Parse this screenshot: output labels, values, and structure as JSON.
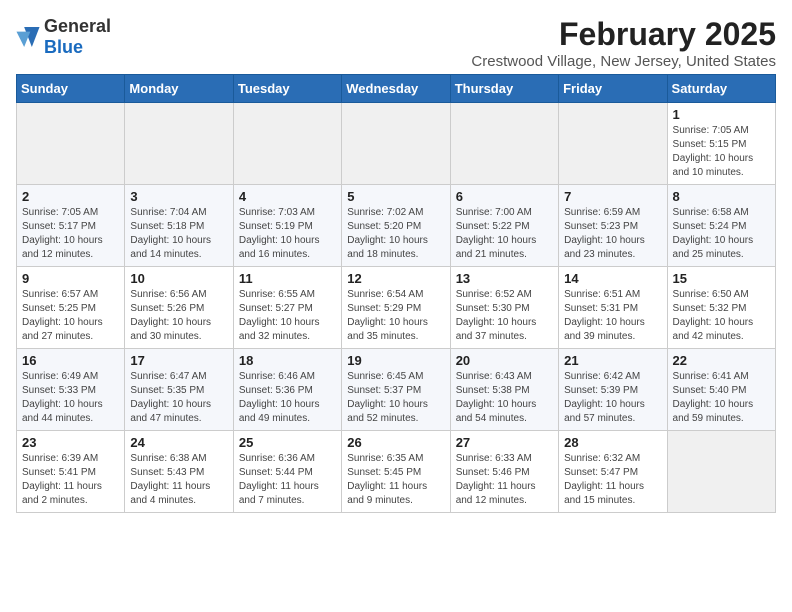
{
  "logo": {
    "general": "General",
    "blue": "Blue"
  },
  "title": "February 2025",
  "location": "Crestwood Village, New Jersey, United States",
  "weekdays": [
    "Sunday",
    "Monday",
    "Tuesday",
    "Wednesday",
    "Thursday",
    "Friday",
    "Saturday"
  ],
  "weeks": [
    [
      {
        "day": "",
        "info": ""
      },
      {
        "day": "",
        "info": ""
      },
      {
        "day": "",
        "info": ""
      },
      {
        "day": "",
        "info": ""
      },
      {
        "day": "",
        "info": ""
      },
      {
        "day": "",
        "info": ""
      },
      {
        "day": "1",
        "info": "Sunrise: 7:05 AM\nSunset: 5:15 PM\nDaylight: 10 hours\nand 10 minutes."
      }
    ],
    [
      {
        "day": "2",
        "info": "Sunrise: 7:05 AM\nSunset: 5:17 PM\nDaylight: 10 hours\nand 12 minutes."
      },
      {
        "day": "3",
        "info": "Sunrise: 7:04 AM\nSunset: 5:18 PM\nDaylight: 10 hours\nand 14 minutes."
      },
      {
        "day": "4",
        "info": "Sunrise: 7:03 AM\nSunset: 5:19 PM\nDaylight: 10 hours\nand 16 minutes."
      },
      {
        "day": "5",
        "info": "Sunrise: 7:02 AM\nSunset: 5:20 PM\nDaylight: 10 hours\nand 18 minutes."
      },
      {
        "day": "6",
        "info": "Sunrise: 7:00 AM\nSunset: 5:22 PM\nDaylight: 10 hours\nand 21 minutes."
      },
      {
        "day": "7",
        "info": "Sunrise: 6:59 AM\nSunset: 5:23 PM\nDaylight: 10 hours\nand 23 minutes."
      },
      {
        "day": "8",
        "info": "Sunrise: 6:58 AM\nSunset: 5:24 PM\nDaylight: 10 hours\nand 25 minutes."
      }
    ],
    [
      {
        "day": "9",
        "info": "Sunrise: 6:57 AM\nSunset: 5:25 PM\nDaylight: 10 hours\nand 27 minutes."
      },
      {
        "day": "10",
        "info": "Sunrise: 6:56 AM\nSunset: 5:26 PM\nDaylight: 10 hours\nand 30 minutes."
      },
      {
        "day": "11",
        "info": "Sunrise: 6:55 AM\nSunset: 5:27 PM\nDaylight: 10 hours\nand 32 minutes."
      },
      {
        "day": "12",
        "info": "Sunrise: 6:54 AM\nSunset: 5:29 PM\nDaylight: 10 hours\nand 35 minutes."
      },
      {
        "day": "13",
        "info": "Sunrise: 6:52 AM\nSunset: 5:30 PM\nDaylight: 10 hours\nand 37 minutes."
      },
      {
        "day": "14",
        "info": "Sunrise: 6:51 AM\nSunset: 5:31 PM\nDaylight: 10 hours\nand 39 minutes."
      },
      {
        "day": "15",
        "info": "Sunrise: 6:50 AM\nSunset: 5:32 PM\nDaylight: 10 hours\nand 42 minutes."
      }
    ],
    [
      {
        "day": "16",
        "info": "Sunrise: 6:49 AM\nSunset: 5:33 PM\nDaylight: 10 hours\nand 44 minutes."
      },
      {
        "day": "17",
        "info": "Sunrise: 6:47 AM\nSunset: 5:35 PM\nDaylight: 10 hours\nand 47 minutes."
      },
      {
        "day": "18",
        "info": "Sunrise: 6:46 AM\nSunset: 5:36 PM\nDaylight: 10 hours\nand 49 minutes."
      },
      {
        "day": "19",
        "info": "Sunrise: 6:45 AM\nSunset: 5:37 PM\nDaylight: 10 hours\nand 52 minutes."
      },
      {
        "day": "20",
        "info": "Sunrise: 6:43 AM\nSunset: 5:38 PM\nDaylight: 10 hours\nand 54 minutes."
      },
      {
        "day": "21",
        "info": "Sunrise: 6:42 AM\nSunset: 5:39 PM\nDaylight: 10 hours\nand 57 minutes."
      },
      {
        "day": "22",
        "info": "Sunrise: 6:41 AM\nSunset: 5:40 PM\nDaylight: 10 hours\nand 59 minutes."
      }
    ],
    [
      {
        "day": "23",
        "info": "Sunrise: 6:39 AM\nSunset: 5:41 PM\nDaylight: 11 hours\nand 2 minutes."
      },
      {
        "day": "24",
        "info": "Sunrise: 6:38 AM\nSunset: 5:43 PM\nDaylight: 11 hours\nand 4 minutes."
      },
      {
        "day": "25",
        "info": "Sunrise: 6:36 AM\nSunset: 5:44 PM\nDaylight: 11 hours\nand 7 minutes."
      },
      {
        "day": "26",
        "info": "Sunrise: 6:35 AM\nSunset: 5:45 PM\nDaylight: 11 hours\nand 9 minutes."
      },
      {
        "day": "27",
        "info": "Sunrise: 6:33 AM\nSunset: 5:46 PM\nDaylight: 11 hours\nand 12 minutes."
      },
      {
        "day": "28",
        "info": "Sunrise: 6:32 AM\nSunset: 5:47 PM\nDaylight: 11 hours\nand 15 minutes."
      },
      {
        "day": "",
        "info": ""
      }
    ]
  ]
}
